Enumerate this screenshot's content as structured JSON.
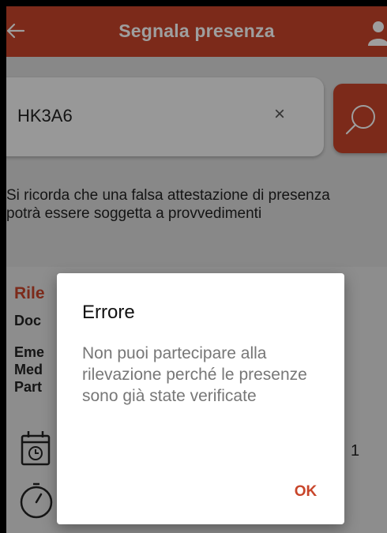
{
  "app_bar": {
    "title": "Segnala presenza",
    "back_icon": "arrow-left-icon",
    "user_icon": "user-icon",
    "color": "#c8452a"
  },
  "search": {
    "value": "HK3A6",
    "clear_label": "×",
    "button_icon": "search-icon"
  },
  "notice": "Si ricorda che una falsa attestazione di presenza potrà essere soggetta a provvedimenti",
  "card": {
    "title_partial": "Rile",
    "lines": [
      "Doc",
      "Eme",
      "Med",
      "Part"
    ],
    "number": "1",
    "calendar_icon": "calendar-clock-icon",
    "timer_icon": "timer-icon"
  },
  "dialog": {
    "title": "Errore",
    "message": "Non puoi partecipare alla rilevazione perché le presenze sono già state verificate",
    "ok_label": "OK"
  }
}
